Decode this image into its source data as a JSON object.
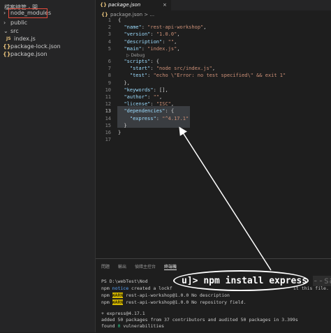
{
  "sidebar": {
    "title": "檔案總管 - 開...",
    "items": [
      {
        "label": "node_modules",
        "type": "folder-collapsed"
      },
      {
        "label": "public",
        "type": "folder-collapsed"
      },
      {
        "label": "src",
        "type": "folder-open"
      },
      {
        "label": "index.js",
        "type": "js",
        "icon_text": "JS"
      },
      {
        "label": "package-lock.json",
        "type": "json",
        "icon_text": "{}"
      },
      {
        "label": "package.json",
        "type": "json",
        "icon_text": "{}"
      }
    ]
  },
  "editor": {
    "tab_label": "package.json",
    "tab_icon": "{}",
    "tab_close": "×",
    "breadcrumb": "package.json > ...",
    "debug_label": "▷ Debug",
    "lines": [
      {
        "n": "1",
        "text": "{"
      },
      {
        "n": "2",
        "text": "  \"name\": \"rest-api-workshop\","
      },
      {
        "n": "3",
        "text": "  \"version\": \"1.0.0\","
      },
      {
        "n": "4",
        "text": "  \"description\": \"\","
      },
      {
        "n": "5",
        "text": "  \"main\": \"index.js\","
      },
      {
        "n": "6",
        "text": "  \"scripts\": {"
      },
      {
        "n": "7",
        "text": "    \"start\": \"node src/index.js\","
      },
      {
        "n": "8",
        "text": "    \"test\": \"echo \\\"Error: no test specified\\\" && exit 1\""
      },
      {
        "n": "9",
        "text": "  },"
      },
      {
        "n": "10",
        "text": "  \"keywords\": [],"
      },
      {
        "n": "11",
        "text": "  \"author\": \"\","
      },
      {
        "n": "12",
        "text": "  \"license\": \"ISC\","
      },
      {
        "n": "13",
        "text": "  \"dependencies\": {"
      },
      {
        "n": "14",
        "text": "    \"express\": \"^4.17.1\""
      },
      {
        "n": "15",
        "text": "  }"
      },
      {
        "n": "16",
        "text": "}"
      },
      {
        "n": "17",
        "text": ""
      }
    ]
  },
  "panel": {
    "tabs": [
      "問題",
      "輸出",
      "偵錯主控台",
      "終端機"
    ],
    "active_tab": "終端機",
    "terminal": {
      "line1_prefix": "PS D:\\webTest\\Nod",
      "line2_a": "npm ",
      "line2_notice": "notice",
      "line2_b": " created a lockf",
      "line2_c": "it this file.",
      "line3_a": "npm ",
      "line3_warn": "WARN",
      "line3_b": " rest-api-workshop@1.0.0 No description",
      "line4_a": "npm ",
      "line4_warn": "WARN",
      "line4_b": " rest-api-workshop@1.0.0 No repository field.",
      "line5": "+ express@4.17.1",
      "line6": "added 50 packages from 37 contributors and audited 50 packages in 3.399s",
      "line7_a": "found ",
      "line7_zero": "0",
      "line7_b": " vulnerabilities"
    }
  },
  "callout": {
    "command": "npm install express ",
    "flag": "--save",
    "prefix": "u]> "
  },
  "colors": {
    "highlight_box": "#e74c3c",
    "warn_bg": "#d7ba00",
    "key": "#9cdcfe",
    "string": "#ce9178"
  }
}
